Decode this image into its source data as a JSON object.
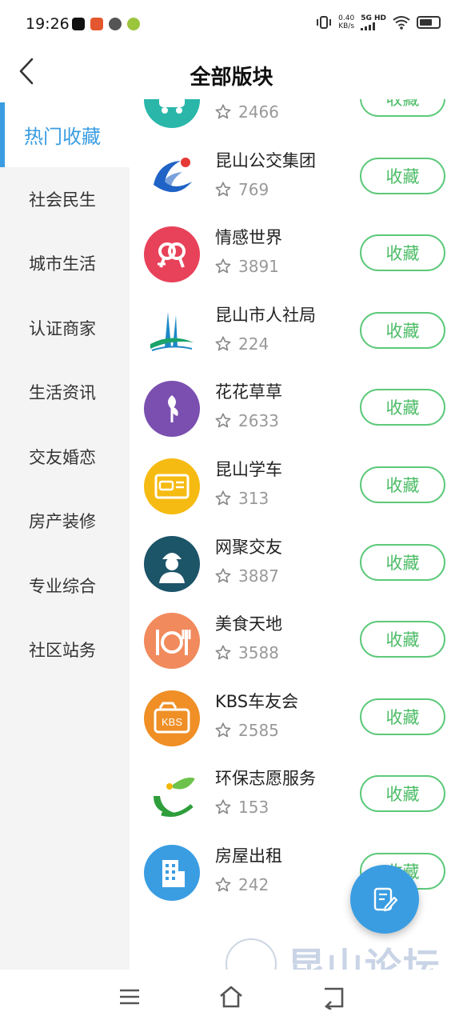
{
  "status_bar": {
    "time": "19:26",
    "net_speed": "0.40",
    "net_unit": "KB/s",
    "network": "5G HD"
  },
  "header": {
    "title": "全部版块"
  },
  "sidebar": {
    "items": [
      {
        "label": "热门收藏",
        "active": true
      },
      {
        "label": "社会民生"
      },
      {
        "label": "城市生活"
      },
      {
        "label": "认证商家"
      },
      {
        "label": "生活资讯"
      },
      {
        "label": "交友婚恋"
      },
      {
        "label": "房产装修"
      },
      {
        "label": "专业综合"
      },
      {
        "label": "社区站务"
      }
    ]
  },
  "forums": [
    {
      "name": "",
      "count": "2466",
      "action": "收藏",
      "color": "#2ab7a9",
      "icon": "bus-icon"
    },
    {
      "name": "昆山公交集团",
      "count": "769",
      "action": "收藏",
      "color": "#ffffff",
      "icon": "bus-group-logo-icon"
    },
    {
      "name": "情感世界",
      "count": "3891",
      "action": "收藏",
      "color": "#e8415a",
      "icon": "gender-hearts-icon"
    },
    {
      "name": "昆山市人社局",
      "count": "224",
      "action": "收藏",
      "color": "#ffffff",
      "icon": "hrss-logo-icon"
    },
    {
      "name": "花花草草",
      "count": "2633",
      "action": "收藏",
      "color": "#7b4fb0",
      "icon": "plant-icon"
    },
    {
      "name": "昆山学车",
      "count": "313",
      "action": "收藏",
      "color": "#f6bb12",
      "icon": "car-license-icon"
    },
    {
      "name": "网聚交友",
      "count": "3887",
      "action": "收藏",
      "color": "#1c5468",
      "icon": "person-icon"
    },
    {
      "name": "美食天地",
      "count": "3588",
      "action": "收藏",
      "color": "#f18a5c",
      "icon": "dining-icon"
    },
    {
      "name": "KBS车友会",
      "count": "2585",
      "action": "收藏",
      "color": "#ef8f25",
      "icon": "kbs-car-icon"
    },
    {
      "name": "环保志愿服务",
      "count": "153",
      "action": "收藏",
      "color": "#ffffff",
      "icon": "eco-leaf-icon"
    },
    {
      "name": "房屋出租",
      "count": "242",
      "action": "收藏",
      "color": "#3a9de2",
      "icon": "building-icon"
    }
  ],
  "watermark": {
    "text": "昆山论坛"
  }
}
